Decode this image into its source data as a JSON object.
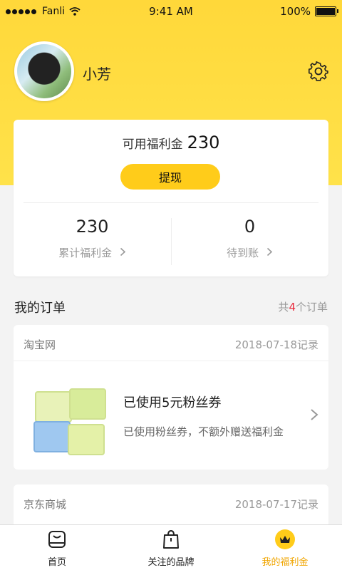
{
  "status": {
    "carrier": "Fanli",
    "time": "9:41 AM",
    "battery": "100%"
  },
  "profile": {
    "name": "小芳"
  },
  "wallet": {
    "available_label": "可用福利金",
    "available_amount": "230",
    "withdraw_label": "提现",
    "stats": [
      {
        "value": "230",
        "label": "累计福利金"
      },
      {
        "value": "0",
        "label": "待到账"
      }
    ]
  },
  "orders_section": {
    "title": "我的订单",
    "count_prefix": "共",
    "count": "4",
    "count_suffix": "个订单"
  },
  "orders": [
    {
      "shop": "淘宝网",
      "date": "2018-07-18记录",
      "title": "已使用5元粉丝券",
      "subtitle": "已使用粉丝券，不额外赠送福利金"
    },
    {
      "shop": "京东商城",
      "date": "2018-07-17记录"
    }
  ],
  "tabs": [
    {
      "label": "首页",
      "icon": "home-icon"
    },
    {
      "label": "关注的品牌",
      "icon": "shopping-bag-icon"
    },
    {
      "label": "我的福利金",
      "icon": "crown-icon",
      "active": true
    }
  ],
  "colors": {
    "accent": "#ffcc1a",
    "active_tab": "#f0a500",
    "count_red": "#e8283a"
  }
}
